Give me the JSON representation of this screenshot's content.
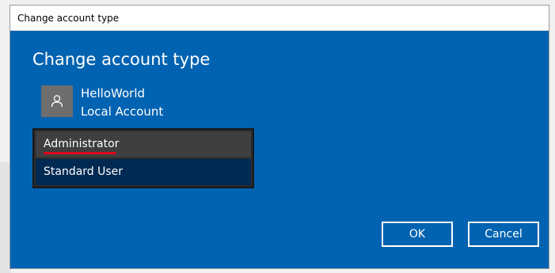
{
  "window": {
    "title": "Change account type"
  },
  "dialog": {
    "heading": "Change account type",
    "account": {
      "name": "HelloWorld",
      "type": "Local Account",
      "avatar_icon": "user-icon"
    },
    "account_type_options": [
      {
        "label": "Administrator",
        "state": "hovered"
      },
      {
        "label": "Standard User",
        "state": "selected"
      }
    ],
    "buttons": {
      "ok_label": "OK",
      "cancel_label": "Cancel"
    }
  },
  "colors": {
    "dialog_background": "#0063b1",
    "listbox_background": "#2b2b2b",
    "hover_option": "#3f3f3f",
    "selected_option": "#002a52",
    "annotation_underline": "#e0001a"
  }
}
